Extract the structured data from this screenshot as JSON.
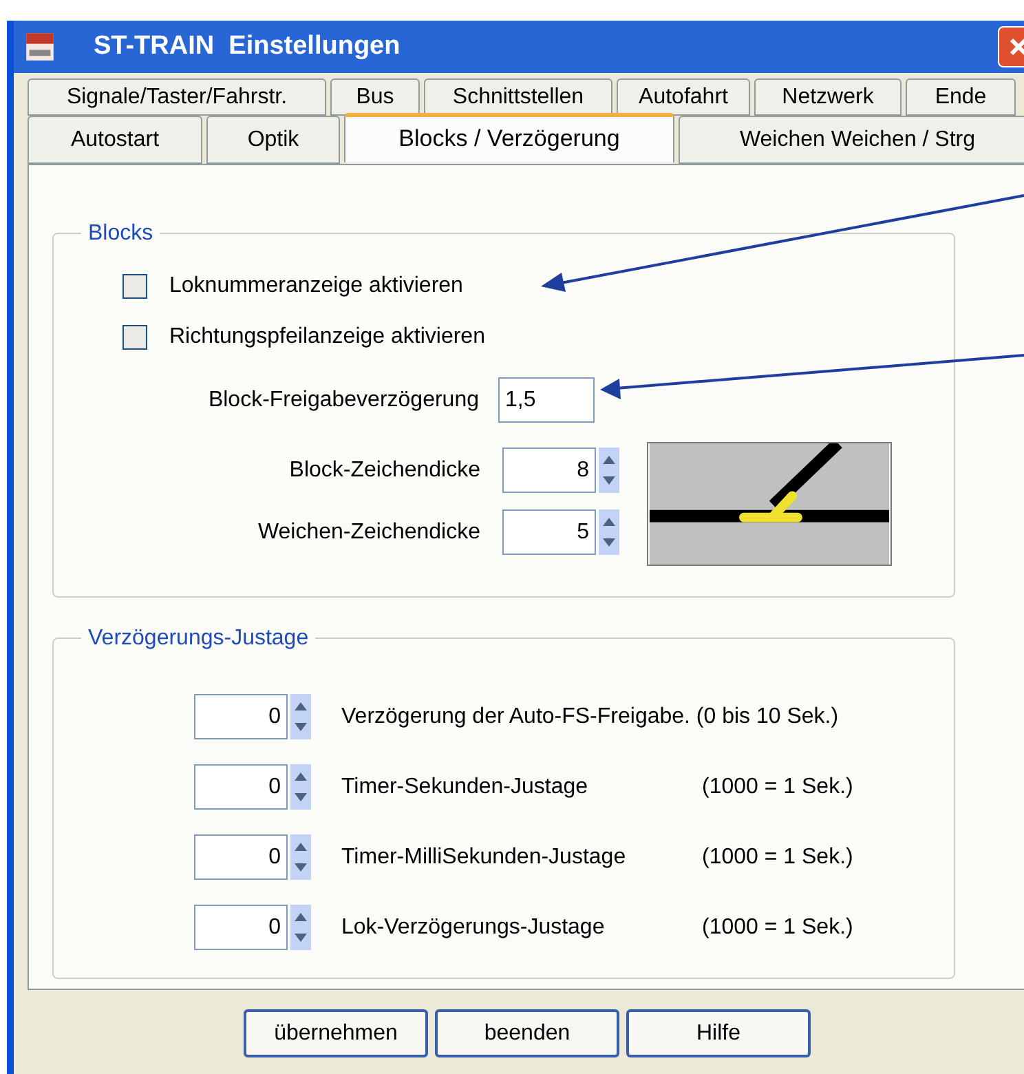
{
  "window": {
    "title": "ST-TRAIN  Einstellungen"
  },
  "tab_rows": [
    [
      {
        "label": "Signale/Taster/Fahrstr.",
        "selected": false
      },
      {
        "label": "Bus",
        "selected": false
      },
      {
        "label": "Schnittstellen",
        "selected": false
      },
      {
        "label": "Autofahrt",
        "selected": false
      },
      {
        "label": "Netzwerk",
        "selected": false
      },
      {
        "label": "Ende",
        "selected": false
      }
    ],
    [
      {
        "label": "Autostart",
        "selected": false
      },
      {
        "label": "Optik",
        "selected": false
      },
      {
        "label": "Blocks / Verzögerung",
        "selected": true
      },
      {
        "label": "Weichen Weichen / Strg",
        "selected": false
      }
    ]
  ],
  "blocks": {
    "title": "Blocks",
    "checkboxes": [
      {
        "label": "Loknummeranzeige aktivieren",
        "checked": false
      },
      {
        "label": "Richtungspfeilanzeige aktivieren",
        "checked": false
      }
    ],
    "release_delay": {
      "label": "Block-Freigabeverzögerung",
      "value": "1,5"
    },
    "thickness": [
      {
        "label": "Block-Zeichendicke",
        "value": "8"
      },
      {
        "label": "Weichen-Zeichendicke",
        "value": "5"
      }
    ]
  },
  "delay_adjust": {
    "title": "Verzögerungs-Justage",
    "rows": [
      {
        "value": "0",
        "label": "Verzögerung der Auto-FS-Freigabe. (0 bis 10 Sek.)"
      },
      {
        "value": "0",
        "label": "Timer-Sekunden-Justage",
        "note": "(1000 = 1 Sek.)"
      },
      {
        "value": "0",
        "label": "Timer-MilliSekunden-Justage",
        "note": "(1000 = 1 Sek.)"
      },
      {
        "value": "0",
        "label": "Lok-Verzögerungs-Justage",
        "note": "(1000 = 1 Sek.)"
      }
    ]
  },
  "buttons": [
    "übernehmen",
    "beenden",
    "Hilfe"
  ]
}
